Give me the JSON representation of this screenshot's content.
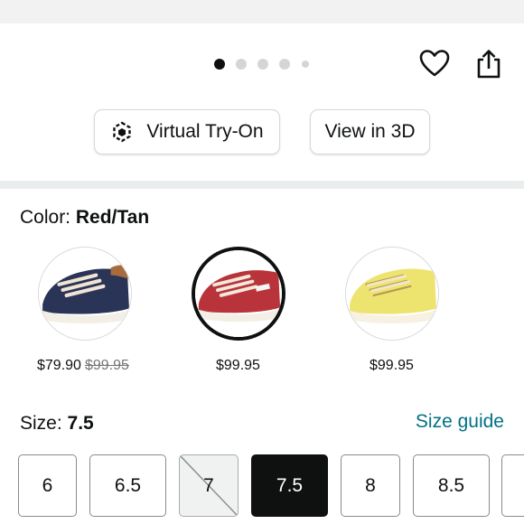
{
  "carousel": {
    "total_dots": 5,
    "active_index": 0
  },
  "actions": {
    "favorite_icon": "heart-icon",
    "share_icon": "share-icon"
  },
  "view_buttons": {
    "virtual_try_on_label": "Virtual Try-On",
    "virtual_try_on_icon": "cube-icon",
    "view_3d_label": "View in 3D"
  },
  "color": {
    "label": "Color:",
    "selected_value": "Red/Tan",
    "options": [
      {
        "name": "Navy",
        "shoe_color": "#2a3456",
        "price": "$79.90",
        "list_price": "$99.95",
        "selected": false
      },
      {
        "name": "Red/Tan",
        "shoe_color": "#b8343a",
        "price": "$99.95",
        "list_price": "",
        "selected": true
      },
      {
        "name": "Yellow",
        "shoe_color": "#ede36f",
        "price": "$99.95",
        "list_price": "",
        "selected": false
      }
    ]
  },
  "size": {
    "label": "Size:",
    "selected_value": "7.5",
    "guide_label": "Size guide",
    "options": [
      {
        "value": "6",
        "state": "available"
      },
      {
        "value": "6.5",
        "state": "available"
      },
      {
        "value": "7",
        "state": "unavailable"
      },
      {
        "value": "7.5",
        "state": "selected"
      },
      {
        "value": "8",
        "state": "available"
      },
      {
        "value": "8.5",
        "state": "available"
      }
    ]
  },
  "colors": {
    "text": "#0f1111",
    "link": "#007185",
    "divider": "#eaeded",
    "selected_size_bg": "#0f1111"
  }
}
